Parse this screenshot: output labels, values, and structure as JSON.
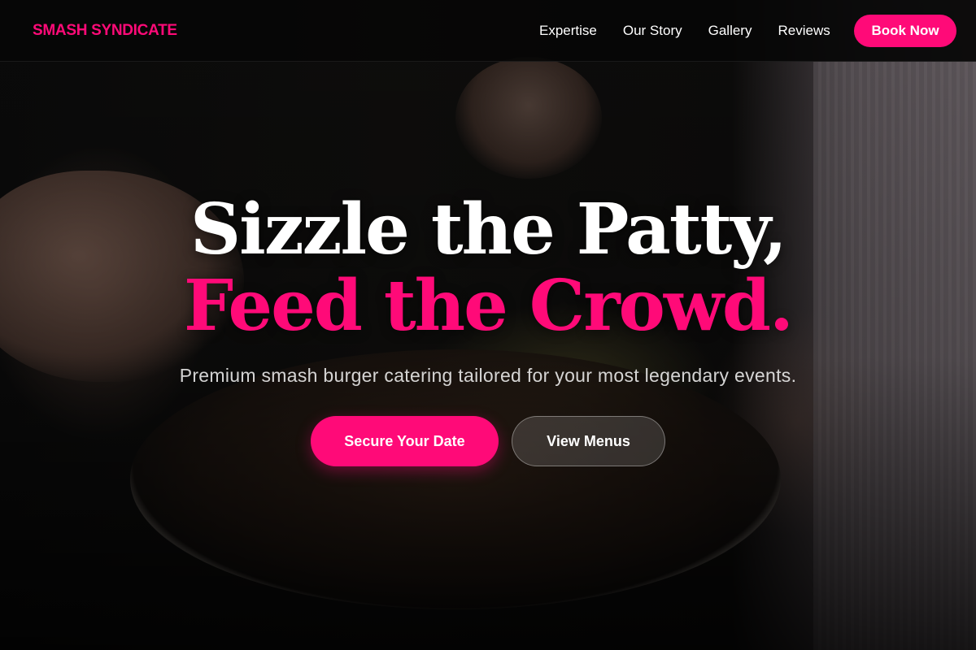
{
  "brand": {
    "logo_text": "SMASH SYNDICATE",
    "accent_color": "#ff0a78"
  },
  "nav": {
    "items": [
      {
        "label": "Expertise"
      },
      {
        "label": "Our Story"
      },
      {
        "label": "Gallery"
      },
      {
        "label": "Reviews"
      }
    ],
    "cta_label": "Book Now"
  },
  "hero": {
    "headline_line1": "Sizzle the Patty,",
    "headline_line2": "Feed the Crowd.",
    "subtitle": "Premium smash burger catering tailored for your most legendary events.",
    "primary_cta": "Secure Your Date",
    "secondary_cta": "View Menus",
    "background_image": "food-bowl-photo"
  }
}
